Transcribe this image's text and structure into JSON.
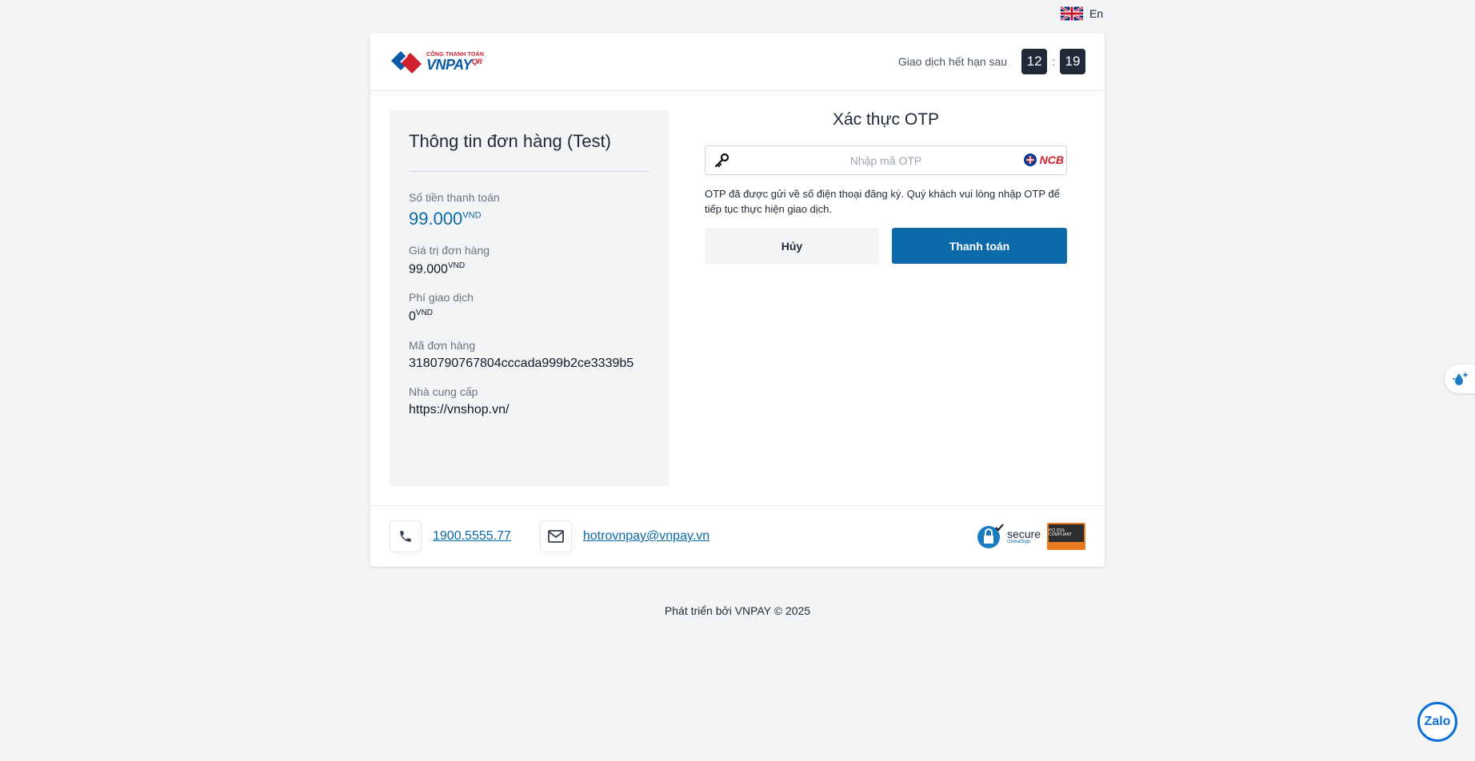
{
  "language": {
    "label": "En",
    "flag_icon": "uk-flag-icon"
  },
  "header": {
    "logo": {
      "small_text": "CỔNG THANH TOÁN",
      "main_text": "VNPAY",
      "suffix": "QR"
    },
    "timer": {
      "label": "Giao dịch hết hạn sau",
      "minutes": "12",
      "separator": ":",
      "seconds": "19"
    }
  },
  "order": {
    "title": "Thông tin đơn hàng (Test)",
    "fields": [
      {
        "label": "Số tiền thanh toán",
        "value": "99.000",
        "currency": "VND"
      },
      {
        "label": "Giá trị đơn hàng",
        "value": "99.000",
        "currency": "VND"
      },
      {
        "label": "Phí giao dịch",
        "value": "0",
        "currency": "VND"
      },
      {
        "label": "Mã đơn hàng",
        "value": "3180790767804cccada999b2ce3339b5"
      },
      {
        "label": "Nhà cung cấp",
        "value": "https://vnshop.vn/"
      }
    ]
  },
  "otp": {
    "title": "Xác thực OTP",
    "placeholder": "Nhập mã OTP",
    "value": "",
    "bank_logo": "NCB",
    "note": "OTP đã được gửi về số điện thoại đăng ký. Quý khách vui lòng nhập OTP để tiếp tục thực hiện giao dịch.",
    "cancel_label": "Hủy",
    "pay_label": "Thanh toán"
  },
  "footer": {
    "phone": "1900.5555.77",
    "email": "hotrovnpay@vnpay.vn",
    "secure_word": "secure",
    "secure_sub": "GlobalSign",
    "pci_text": "PCI DSS COMPLIANT"
  },
  "page_footer": "Phát triển bởi VNPAY © 2025",
  "zalo_label": "Zalo",
  "colors": {
    "primary": "#0c6aa8",
    "dark": "#1f2937",
    "panel": "#f3f4f6",
    "brand_red": "#d0202e"
  }
}
